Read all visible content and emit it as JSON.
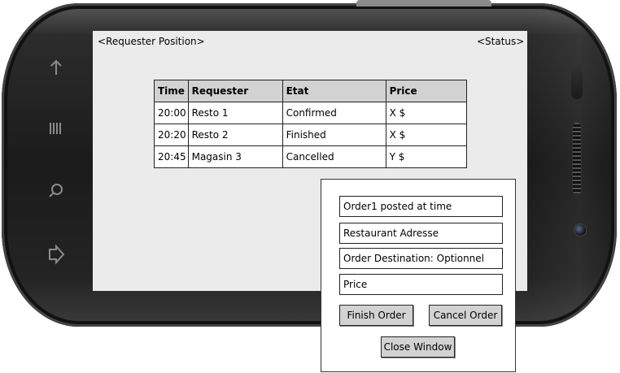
{
  "header": {
    "requester_position": "<Requester Position>",
    "status": "<Status>"
  },
  "table": {
    "columns": [
      "Time",
      "Requester",
      "Etat",
      "Price"
    ],
    "rows": [
      [
        "20:00",
        "Resto 1",
        "Confirmed",
        "X $"
      ],
      [
        "20:20",
        "Resto 2",
        "Finished",
        "X $"
      ],
      [
        "20:45",
        "Magasin 3",
        "Cancelled",
        "Y $"
      ]
    ]
  },
  "popup": {
    "fields": [
      "Order1 posted at time",
      "Restaurant Adresse",
      "Order Destination: Optionnel",
      "Price"
    ],
    "finish_label": "Finish Order",
    "cancel_label": "Cancel Order",
    "close_label": "Close Window"
  },
  "device": {
    "nav_icons": [
      "back-icon",
      "menu-icon",
      "search-icon",
      "forward-icon"
    ]
  },
  "colors": {
    "screen_bg": "#ebebeb",
    "header_bg": "#d2d2d2",
    "button_bg": "#d2d2d2"
  }
}
